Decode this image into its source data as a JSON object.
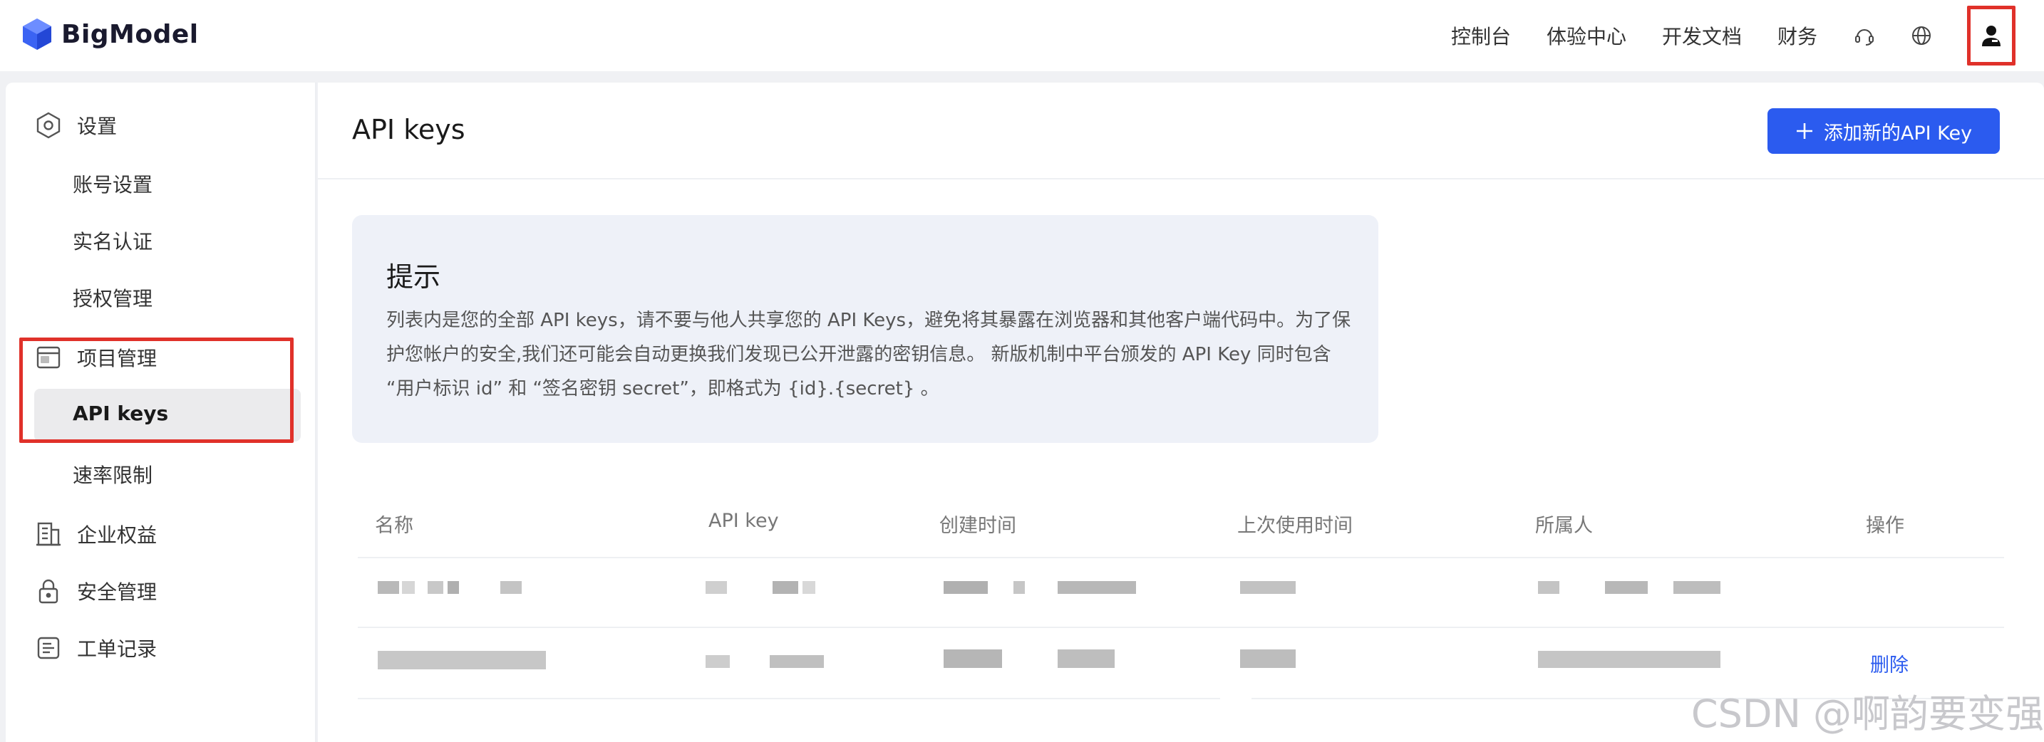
{
  "brand": {
    "name": "BigModel",
    "color": "#2b5bef"
  },
  "topnav": {
    "items": [
      "控制台",
      "体验中心",
      "开发文档",
      "财务"
    ],
    "icons": [
      "headset-icon",
      "globe-icon",
      "user-icon"
    ]
  },
  "sidebar": {
    "settings": "设置",
    "account": "账号设置",
    "realname": "实名认证",
    "authorization": "授权管理",
    "project": "项目管理",
    "apikeys": "API keys",
    "ratelimit": "速率限制",
    "enterprise": "企业权益",
    "security": "安全管理",
    "tickets": "工单记录"
  },
  "main": {
    "title": "API keys",
    "add_button": "添加新的API Key",
    "notice": {
      "title": "提示",
      "text": "列表内是您的全部 API keys，请不要与他人共享您的 API Keys，避免将其暴露在浏览器和其他客户端代码中。为了保护您帐户的安全,我们还可能会自动更换我们发现已公开泄露的密钥信息。 新版机制中平台颁发的 API Key 同时包含 “用户标识 id” 和 “签名密钥 secret”，即格式为 {id}.{secret} 。"
    },
    "table": {
      "headers": [
        "名称",
        "API key",
        "创建时间",
        "上次使用时间",
        "所属人",
        "操作"
      ],
      "rows": [
        {
          "action": ""
        },
        {
          "action": "删除"
        }
      ]
    }
  },
  "watermark": "CSDN @啊韵要变强",
  "colors": {
    "accent": "#2b5bef",
    "highlight": "#e0312a"
  }
}
